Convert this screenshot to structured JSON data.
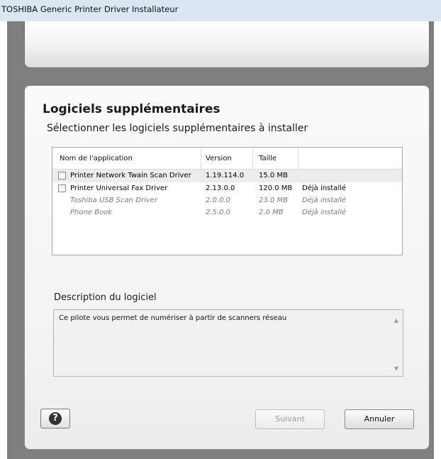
{
  "window": {
    "title": "TOSHIBA Generic Printer Driver Installateur"
  },
  "section": {
    "heading": "Logiciels supplémentaires",
    "subheading": "Sélectionner les logiciels supplémentaires à installer"
  },
  "table": {
    "columns": [
      "Nom de l'application",
      "Version",
      "Taille",
      ""
    ],
    "rows": [
      {
        "name": "Printer Network Twain Scan Driver",
        "version": "1.19.114.0",
        "size": "15.0 MB",
        "status": "",
        "checked": false,
        "selected": true,
        "child": false
      },
      {
        "name": "Printer Universal Fax Driver",
        "version": "2.13.0.0",
        "size": "120.0 MB",
        "status": "Déjà installé",
        "checked": false,
        "selected": false,
        "child": false
      },
      {
        "name": "Toshiba USB Scan Driver",
        "version": "2.0.0.0",
        "size": "23.0 MB",
        "status": "Déjà installé",
        "checked": false,
        "selected": false,
        "child": true
      },
      {
        "name": "Phone Book",
        "version": "2.5.0.0",
        "size": "2.0 MB",
        "status": "Déjà installé",
        "checked": false,
        "selected": false,
        "child": true
      }
    ]
  },
  "description": {
    "title": "Description du logiciel",
    "text": "Ce pilote vous permet de numériser à partir de scanners réseau"
  },
  "buttons": {
    "next": "Suivant",
    "next_enabled": false,
    "cancel": "Annuler",
    "help_icon": "question-mark-icon"
  }
}
